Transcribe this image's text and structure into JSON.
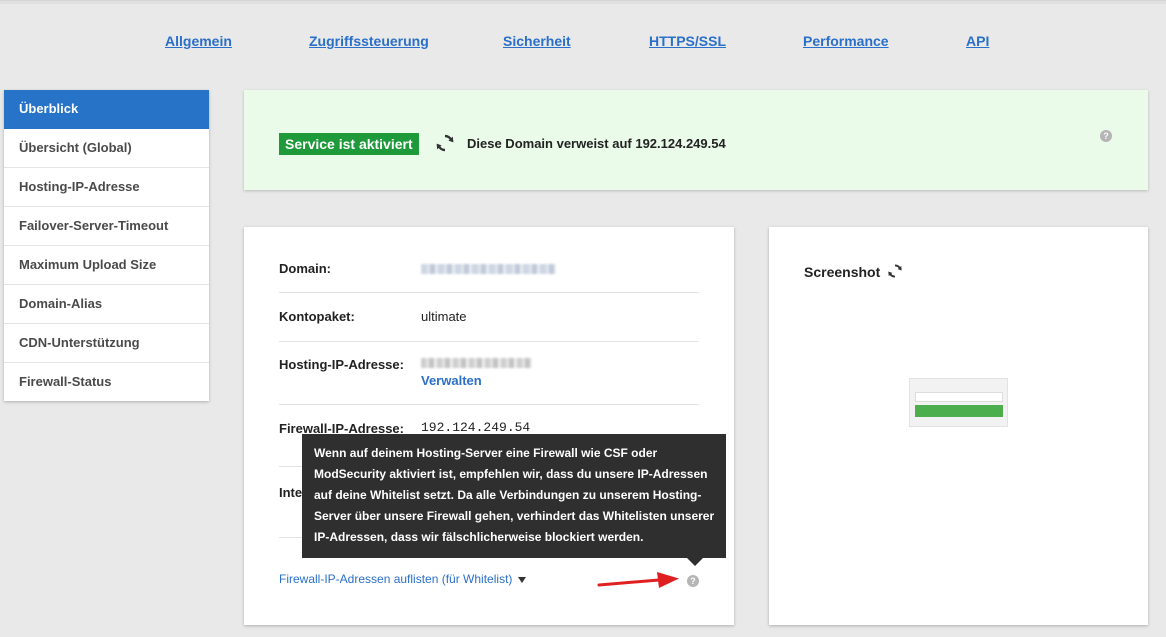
{
  "nav": {
    "items": [
      {
        "label": "Allgemein"
      },
      {
        "label": "Zugriffssteuerung"
      },
      {
        "label": "Sicherheit"
      },
      {
        "label": "HTTPS/SSL"
      },
      {
        "label": "Performance"
      },
      {
        "label": "API"
      }
    ]
  },
  "sidebar": {
    "items": [
      {
        "label": "Überblick",
        "active": true
      },
      {
        "label": "Übersicht (Global)"
      },
      {
        "label": "Hosting-IP-Adresse"
      },
      {
        "label": "Failover-Server-Timeout"
      },
      {
        "label": "Maximum Upload Size"
      },
      {
        "label": "Domain-Alias"
      },
      {
        "label": "CDN-Unterstützung"
      },
      {
        "label": "Firewall-Status"
      }
    ]
  },
  "status": {
    "badge": "Service ist aktiviert",
    "message": "Diese Domain verweist auf 192.124.249.54",
    "help": "?"
  },
  "info": {
    "domain_label": "Domain:",
    "kontopaket_label": "Kontopaket:",
    "kontopaket_value": "ultimate",
    "hosting_ip_label": "Hosting-IP-Adresse:",
    "manage_link": "Verwalten",
    "firewall_ip_label": "Firewall-IP-Adresse:",
    "firewall_ip_value": "192.124.249.54",
    "internal_label_partial": "Inte",
    "list_toggle": "Firewall-IP-Adressen auflisten (für Whitelist)",
    "help": "?"
  },
  "tooltip": {
    "text": "Wenn auf deinem Hosting-Server eine Firewall wie CSF oder ModSecurity aktiviert ist, empfehlen wir, dass du unsere IP-Adressen auf deine Whitelist setzt. Da alle Verbindungen zu unserem Hosting-Server über unsere Firewall gehen, verhindert das Whitelisten unserer IP-Adressen, dass wir fälschlicherweise blockiert werden."
  },
  "screenshot": {
    "title": "Screenshot"
  },
  "colors": {
    "accent": "#2673c8",
    "success": "#1f9a3a",
    "banner_bg": "#eafbea",
    "tooltip_bg": "#2f2f2f",
    "annotation_arrow": "#e02020"
  }
}
